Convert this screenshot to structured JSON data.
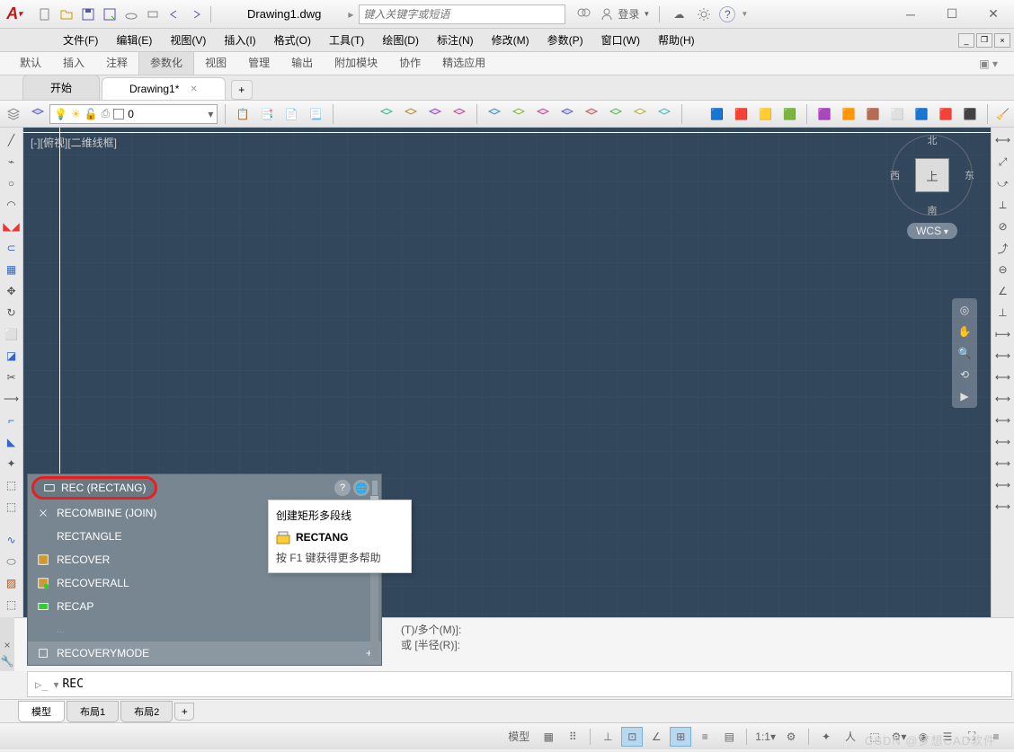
{
  "title": "Drawing1.dwg",
  "search_placeholder": "键入关键字或短语",
  "login_label": "登录",
  "menubar": [
    "文件(F)",
    "编辑(E)",
    "视图(V)",
    "插入(I)",
    "格式(O)",
    "工具(T)",
    "绘图(D)",
    "标注(N)",
    "修改(M)",
    "参数(P)",
    "窗口(W)",
    "帮助(H)"
  ],
  "ribbon_tabs": [
    "默认",
    "插入",
    "注释",
    "参数化",
    "视图",
    "管理",
    "输出",
    "附加模块",
    "协作",
    "精选应用"
  ],
  "ribbon_active": "参数化",
  "file_tabs": {
    "start": "开始",
    "active": "Drawing1*"
  },
  "layer": {
    "name": "0"
  },
  "viewport_label": "[-][俯视][二维线框]",
  "viewcube": {
    "top": "上",
    "n": "北",
    "s": "南",
    "w": "西",
    "e": "东",
    "wcs": "WCS"
  },
  "autocomplete": {
    "selected": "REC (RECTANG)",
    "items": [
      {
        "t": "RECOMBINE (JOIN)",
        "i": "join"
      },
      {
        "t": "RECTANGLE",
        "i": ""
      },
      {
        "t": "RECOVER",
        "i": "recover"
      },
      {
        "t": "RECOVERALL",
        "i": "recoverall"
      },
      {
        "t": "RECAP",
        "i": "recap"
      },
      {
        "t": "RECOVERYMODE",
        "i": "var",
        "hl": true
      }
    ]
  },
  "tooltip": {
    "desc": "创建矩形多段线",
    "cmd": "RECTANG",
    "help": "按 F1 键获得更多帮助"
  },
  "cmd_history": {
    "l1": "(T)/多个(M)]:",
    "l2": "或 [半径(R)]:"
  },
  "cmd_input": "REC",
  "layout_tabs": [
    "模型",
    "布局1",
    "布局2"
  ],
  "status": {
    "space": "模型",
    "scale": "1:1"
  },
  "watermark": "CSDN @梦想CAD软件"
}
